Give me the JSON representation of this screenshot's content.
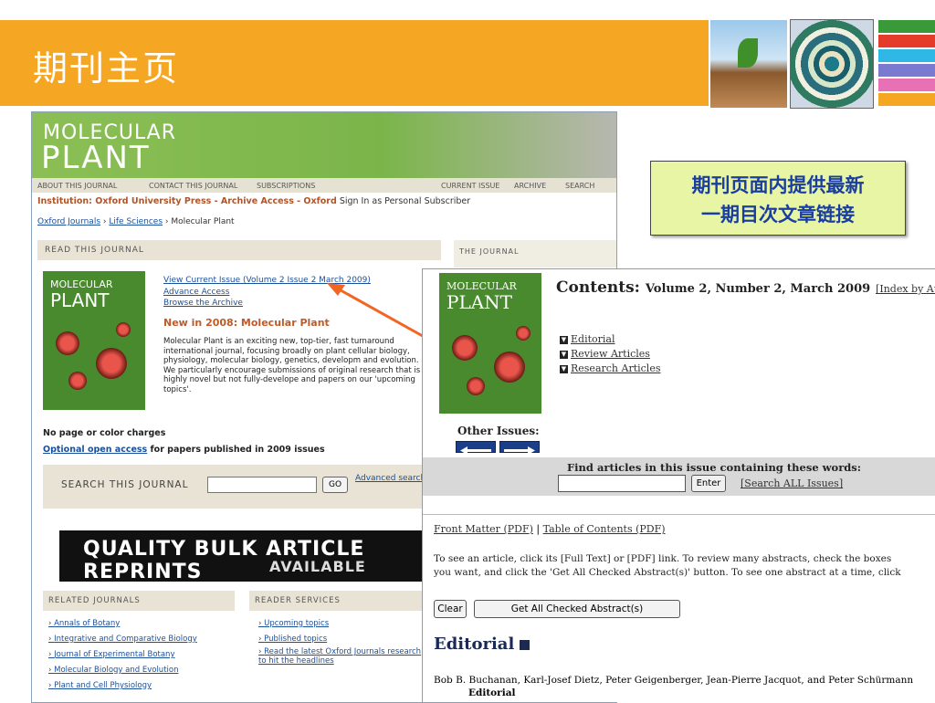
{
  "slide": {
    "title": "期刊主页",
    "stripe_colors": [
      "#3a9a3a",
      "#e53b2b",
      "#2fb7e6",
      "#7a7ad0",
      "#e870b4",
      "#f5a623"
    ],
    "banner_color": "#f5a623"
  },
  "callout": {
    "line1": "期刊页面内提供最新",
    "line2": "一期目次文章链接"
  },
  "journal_page": {
    "logo_line1": "MOLECULAR",
    "logo_line2": "PLANT",
    "nav_left": [
      "ABOUT THIS JOURNAL",
      "CONTACT THIS JOURNAL",
      "SUBSCRIPTIONS"
    ],
    "nav_right": [
      "CURRENT ISSUE",
      "ARCHIVE",
      "SEARCH"
    ],
    "institution_prefix": "Institution: Oxford University Press - Archive Access - Oxford",
    "institution_suffix": "Sign In as Personal Subscriber",
    "breadcrumb": [
      "Oxford Journals",
      "Life Sciences",
      "Molecular Plant"
    ],
    "read_header": "READ THIS JOURNAL",
    "journal_header": "THE JOURNAL",
    "links": [
      "View Current Issue (Volume 2 Issue 2 March 2009)",
      "Advance Access",
      "Browse the Archive"
    ],
    "new_heading": "New in 2008: Molecular Plant",
    "description": "Molecular Plant is an exciting new, top-tier, fast turnaround international journal, focusing broadly on plant cellular biology, physiology, molecular biology, genetics, developm and evolution. We particularly encourage submissions of original research that is highly novel but not fully-develope and papers on our 'upcoming topics'.",
    "no_charges": "No page or color charges",
    "open_access_link": "Optional open access",
    "open_access_rest": "for papers published in 2009 issues",
    "search_label": "SEARCH THIS JOURNAL",
    "go_button": "GO",
    "advanced_search": "Advanced search",
    "reprints_line1": "QUALITY BULK ARTICLE REPRINTS",
    "reprints_line2": "AVAILABLE",
    "related_header": "RELATED JOURNALS",
    "services_header": "READER SERVICES",
    "related_journals": [
      "Annals of Botany",
      "Integrative and Comparative Biology",
      "Journal of Experimental Botany",
      "Molecular Biology and Evolution",
      "Plant and Cell Physiology"
    ],
    "reader_services": [
      "Upcoming topics",
      "Published topics",
      "Read the latest Oxford Journals research to hit the headlines"
    ]
  },
  "contents_page": {
    "title": "Contents:",
    "subtitle": "Volume 2, Number 2, March 2009",
    "index_link": "[Index by Au",
    "sections": [
      "Editorial",
      "Review Articles",
      "Research Articles"
    ],
    "other_issues": "Other Issues:",
    "find_text": "Find articles in this issue containing these words:",
    "enter_button": "Enter",
    "search_all": "[Search ALL Issues]",
    "front_matter": "Front Matter (PDF)",
    "toc_pdf": "Table of Contents (PDF)",
    "instructions_line1": "To see an article, click its [Full Text] or [PDF] link. To review many abstracts, check the boxes",
    "instructions_line2": "you want, and click the 'Get All Checked Abstract(s)' button. To see one abstract at a time, click",
    "clear_button": "Clear",
    "get_abstracts_button": "Get All Checked Abstract(s)",
    "editorial_heading": "Editorial",
    "authors": "Bob B. Buchanan, Karl-Josef Dietz, Peter Geigenberger, Jean-Pierre Jacquot, and Peter Schürmann",
    "article_type": "Editorial"
  }
}
